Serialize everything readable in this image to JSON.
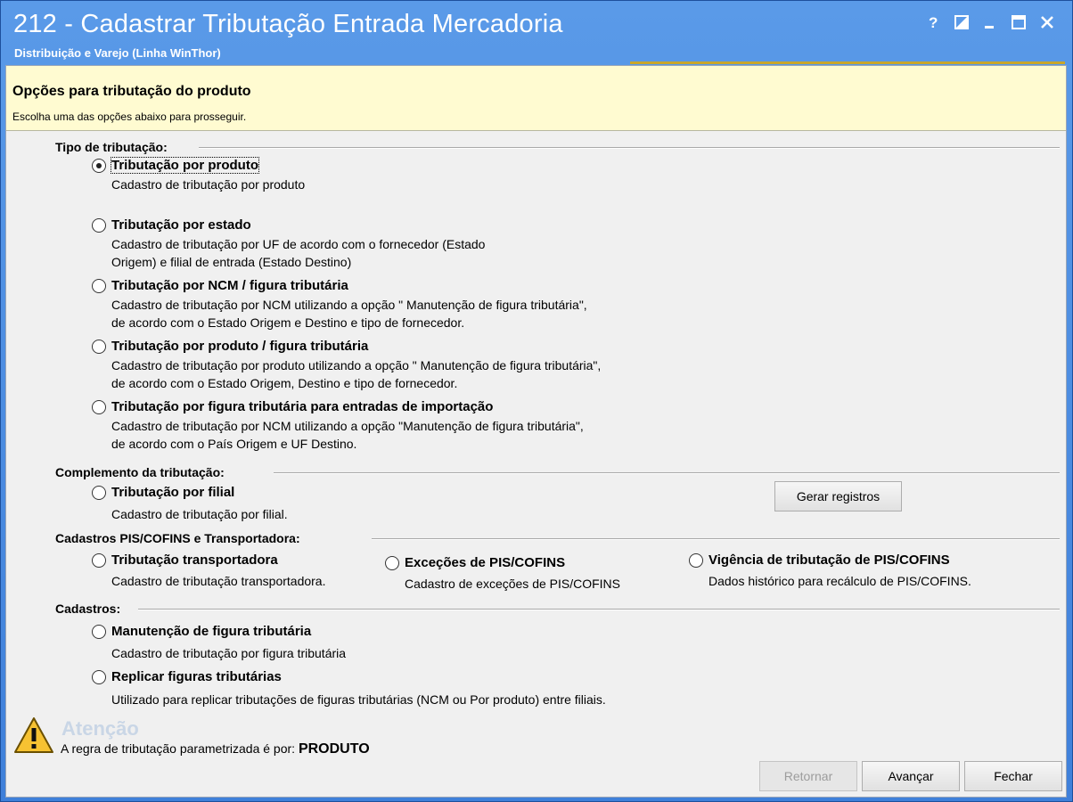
{
  "window": {
    "title": "212 - Cadastrar Tributação Entrada Mercadoria",
    "subtitle": "Distribuição e Varejo (Linha WinThor)",
    "controls": [
      "help-icon",
      "restore-window-icon",
      "minimize-icon",
      "maximize-icon",
      "close-icon"
    ]
  },
  "header": {
    "title": "Opções para tributação do produto",
    "subtitle": "Escolha uma das opções abaixo para prosseguir."
  },
  "groups": {
    "tipo": "Tipo de tributação:",
    "complemento": "Complemento da tributação:",
    "pis": "Cadastros PIS/COFINS e Transportadora:",
    "cadastros": "Cadastros:"
  },
  "options": {
    "por_produto": {
      "label": "Tributação por produto",
      "desc1": "Cadastro de tributação por produto",
      "checked": true
    },
    "por_estado": {
      "label": "Tributação por estado",
      "desc1": "Cadastro de tributação por UF de acordo com o fornecedor (Estado",
      "desc2": "Origem) e filial de entrada (Estado Destino)"
    },
    "por_ncm": {
      "label": "Tributação por NCM / figura tributária",
      "desc1": "Cadastro de tributação por NCM utilizando a opção \" Manutenção de figura tributária\",",
      "desc2": "de acordo com o Estado Origem e Destino e tipo de fornecedor."
    },
    "por_produto_figura": {
      "label": "Tributação por produto / figura tributária",
      "desc1": "Cadastro de tributação por produto utilizando a opção \" Manutenção de figura tributária\",",
      "desc2": "de acordo com o Estado Origem, Destino e tipo de fornecedor."
    },
    "importacao": {
      "label": "Tributação por figura tributária para entradas de importação",
      "desc1": "Cadastro de tributação por NCM utilizando a opção \"Manutenção de figura tributária\",",
      "desc2": "de acordo com o País Origem e UF Destino."
    },
    "por_filial": {
      "label": "Tributação por filial",
      "desc1": "Cadastro de tributação por filial."
    },
    "transportadora": {
      "label": "Tributação  transportadora",
      "desc1": "Cadastro de tributação transportadora."
    },
    "excecoes_pis": {
      "label": "Exceções de PIS/COFINS",
      "desc1": "Cadastro de exceções de PIS/COFINS"
    },
    "vigencia_pis": {
      "label": "Vigência de tributação de PIS/COFINS",
      "desc1": "Dados histórico para recálculo de PIS/COFINS."
    },
    "manutencao_figura": {
      "label": "Manutenção de figura tributária",
      "desc1": "Cadastro de tributação por figura tributária"
    },
    "replicar": {
      "label": "Replicar figuras tributárias",
      "desc1": "Utilizado para replicar tributações de figuras tributárias (NCM ou Por produto) entre filiais."
    }
  },
  "buttons": {
    "gerar": "Gerar registros",
    "retornar": "Retornar",
    "avancar": "Avançar",
    "fechar": "Fechar"
  },
  "warning": {
    "title": "Atenção",
    "text": "A regra de tributação parametrizada é por: ",
    "value": "PRODUTO"
  }
}
